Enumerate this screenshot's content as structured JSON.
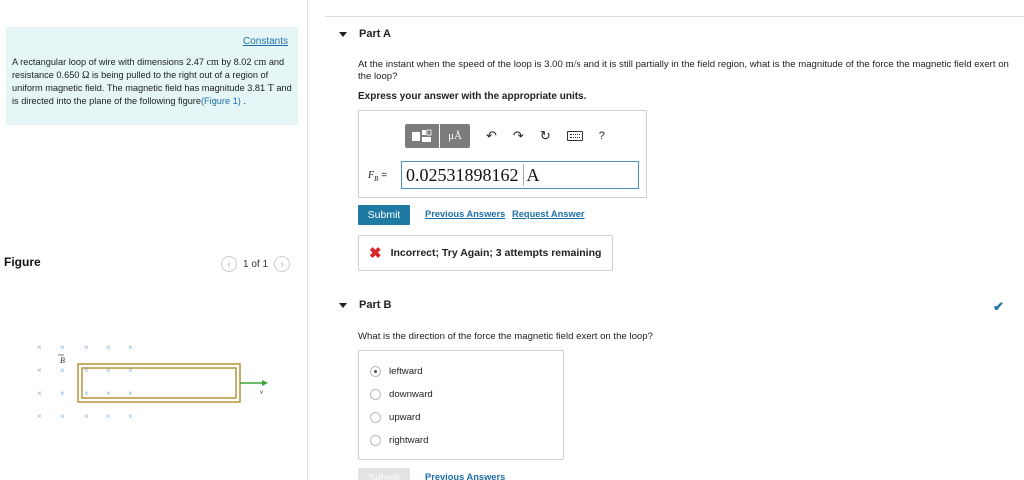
{
  "problem": {
    "constants_link": "Constants",
    "text_part1": "A rectangular loop of wire with dimensions 2.47 ",
    "unit_cm_1": "cm",
    "text_part2": " by 8.02 ",
    "unit_cm_2": "cm",
    "text_part3": " and resistance 0.650 ",
    "unit_ohm": "Ω",
    "text_part4": " is being pulled to the right out of a region of uniform magnetic field. The magnetic field has magnitude 3.81 ",
    "unit_tesla": "T",
    "text_part5": " and is directed into the plane of the following figure",
    "figure_link": "(Figure 1)",
    "text_end": " ."
  },
  "figure": {
    "label": "Figure",
    "pager_text": "1 of 1",
    "prev_icon": "chevron-left-icon",
    "next_icon": "chevron-right-icon",
    "field_symbol": "×",
    "b_label": "B",
    "v_label": "v",
    "arrow_color": "#3aa53a",
    "loop_color": "#b58a2a"
  },
  "part_a": {
    "title": "Part A",
    "question_part1": "At the instant when the speed of the loop is 3.00 ",
    "question_unit": "m/s",
    "question_part2": " and it is still partially in the field region, what is the magnitude of the force the magnetic field exert on the loop?",
    "instruction": "Express your answer with the appropriate units.",
    "toolbar": {
      "units_label": "μÅ",
      "undo_icon": "↶",
      "redo_icon": "↷",
      "reset_icon": "↻",
      "help_label": "?"
    },
    "answer_label": "F",
    "answer_label_sub": "B",
    "answer_eq": " =",
    "answer_value": "0.02531898162",
    "answer_unit": "A",
    "submit_label": "Submit",
    "previous_answers": "Previous Answers",
    "request_answer": "Request Answer",
    "feedback_icon": "✖",
    "feedback_text": "Incorrect; Try Again; 3 attempts remaining"
  },
  "part_b": {
    "title": "Part B",
    "check_icon": "✔",
    "question": "What is the direction of the force the magnetic field exert on the loop?",
    "options": [
      {
        "label": "leftward",
        "selected": true
      },
      {
        "label": "downward",
        "selected": false
      },
      {
        "label": "upward",
        "selected": false
      },
      {
        "label": "rightward",
        "selected": false
      }
    ],
    "submit_label": "Submit",
    "previous_answers": "Previous Answers"
  },
  "colors": {
    "accent": "#1e79a3",
    "link": "#1f6fa8",
    "problem_bg": "#e5f6f6",
    "error": "#d8262b"
  }
}
